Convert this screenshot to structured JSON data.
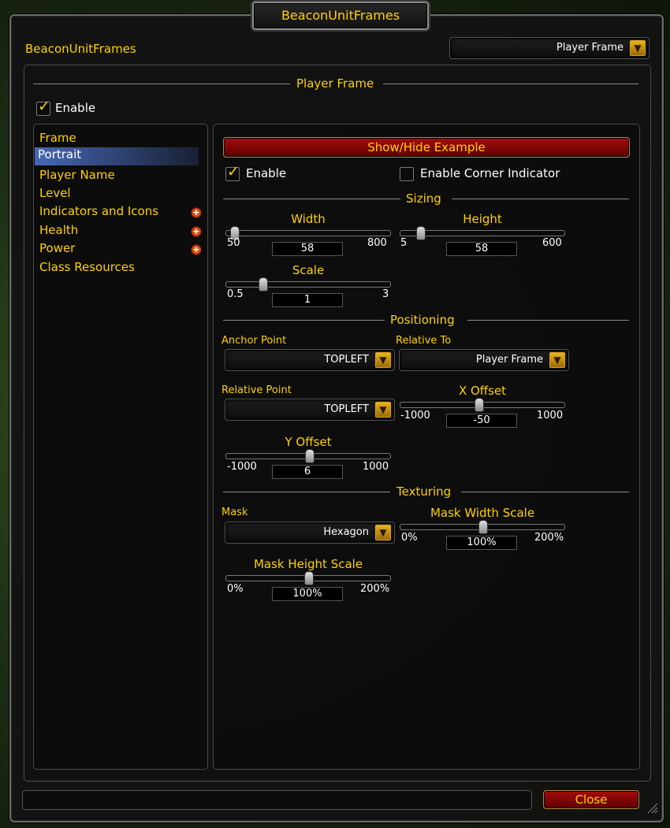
{
  "window": {
    "title": "BeaconUnitFrames",
    "app_label": "BeaconUnitFrames"
  },
  "frame_selector": {
    "value": "Player Frame"
  },
  "section": {
    "title": "Player Frame",
    "enable_label": "Enable",
    "enabled": true
  },
  "sidebar": {
    "items": [
      {
        "label": "Frame",
        "selected": false,
        "expandable": false
      },
      {
        "label": "Portrait",
        "selected": true,
        "expandable": false
      },
      {
        "label": "Player Name",
        "selected": false,
        "expandable": false
      },
      {
        "label": "Level",
        "selected": false,
        "expandable": false
      },
      {
        "label": "Indicators and Icons",
        "selected": false,
        "expandable": true
      },
      {
        "label": "Health",
        "selected": false,
        "expandable": true
      },
      {
        "label": "Power",
        "selected": false,
        "expandable": true
      },
      {
        "label": "Class Resources",
        "selected": false,
        "expandable": false
      }
    ]
  },
  "portrait": {
    "show_hide_label": "Show/Hide Example",
    "enable_label": "Enable",
    "enable_checked": true,
    "corner_label": "Enable Corner Indicator",
    "corner_checked": false,
    "sizing_title": "Sizing",
    "width": {
      "label": "Width",
      "min": "50",
      "max": "800",
      "value": "58",
      "fraction": 0.011
    },
    "height": {
      "label": "Height",
      "min": "5",
      "max": "600",
      "value": "58",
      "fraction": 0.089
    },
    "scale": {
      "label": "Scale",
      "min": "0.5",
      "max": "3",
      "value": "1",
      "fraction": 0.2
    },
    "positioning_title": "Positioning",
    "anchor_point": {
      "label": "Anchor Point",
      "value": "TOPLEFT"
    },
    "relative_to": {
      "label": "Relative To",
      "value": "Player Frame"
    },
    "relative_point": {
      "label": "Relative Point",
      "value": "TOPLEFT"
    },
    "x_offset": {
      "label": "X Offset",
      "min": "-1000",
      "max": "1000",
      "value": "-50",
      "fraction": 0.475
    },
    "y_offset": {
      "label": "Y Offset",
      "min": "-1000",
      "max": "1000",
      "value": "6",
      "fraction": 0.503
    },
    "texturing_title": "Texturing",
    "mask": {
      "label": "Mask",
      "value": "Hexagon"
    },
    "mask_width_scale": {
      "label": "Mask Width Scale",
      "min": "0%",
      "max": "200%",
      "value": "100%",
      "fraction": 0.5
    },
    "mask_height_scale": {
      "label": "Mask Height Scale",
      "min": "0%",
      "max": "200%",
      "value": "100%",
      "fraction": 0.5
    }
  },
  "footer": {
    "close_label": "Close"
  },
  "colors": {
    "gold": "#ffd100",
    "highlight": "#4f78d2",
    "button_red": "#8b0606"
  }
}
